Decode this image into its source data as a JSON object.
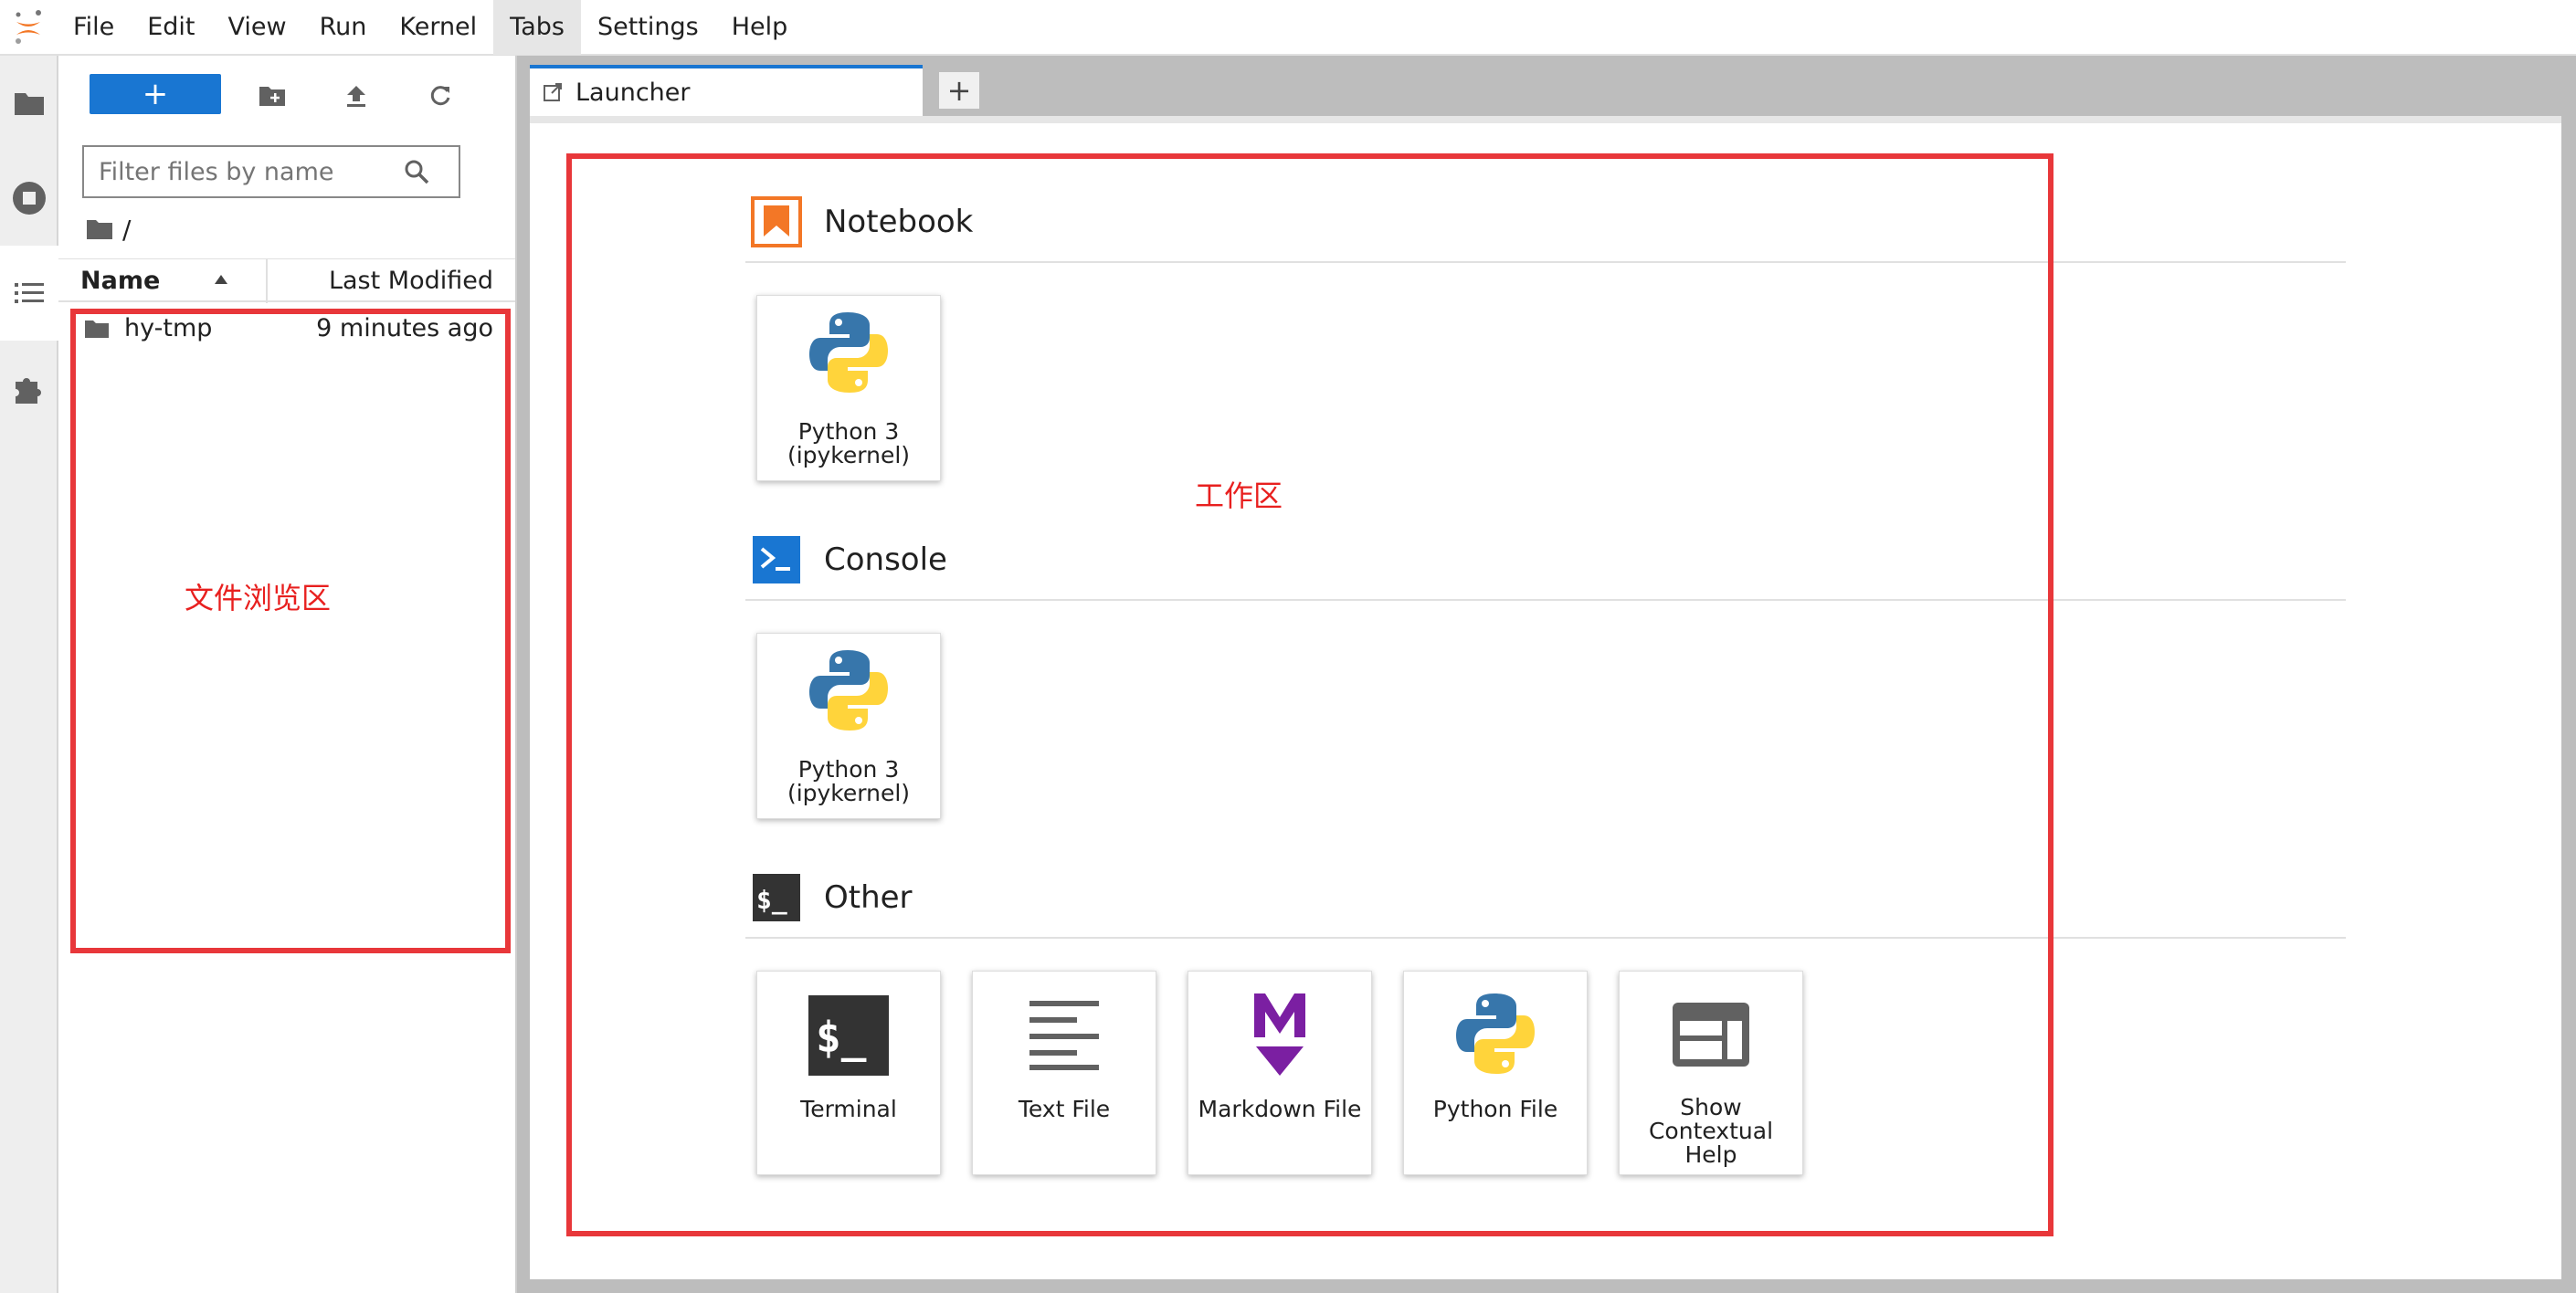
{
  "menubar": {
    "items": [
      "File",
      "Edit",
      "View",
      "Run",
      "Kernel",
      "Tabs",
      "Settings",
      "Help"
    ],
    "active_index": 5
  },
  "activity_bar": {
    "icons": [
      "folder-icon",
      "running-icon",
      "toc-icon",
      "extension-icon"
    ],
    "active_index": 2
  },
  "file_browser": {
    "new_button_label": "+",
    "filter_placeholder": "Filter files by name",
    "breadcrumb": "/",
    "columns": {
      "name": "Name",
      "modified": "Last Modified"
    },
    "rows": [
      {
        "name": "hy-tmp",
        "modified": "9 minutes ago",
        "type": "folder"
      }
    ],
    "annotation": "文件浏览区"
  },
  "tabs": {
    "launcher_label": "Launcher",
    "add_label": "+"
  },
  "launcher": {
    "annotation": "工作区",
    "sections": {
      "notebook": {
        "title": "Notebook",
        "cards": [
          {
            "line1": "Python 3",
            "line2": "(ipykernel)"
          }
        ]
      },
      "console": {
        "title": "Console",
        "cards": [
          {
            "line1": "Python 3",
            "line2": "(ipykernel)"
          }
        ]
      },
      "other": {
        "title": "Other",
        "cards": [
          {
            "label": "Terminal"
          },
          {
            "label": "Text File"
          },
          {
            "label": "Markdown File"
          },
          {
            "label": "Python File"
          },
          {
            "line1": "Show",
            "line2": "Contextual",
            "line3": "Help"
          }
        ]
      }
    }
  },
  "colors": {
    "accent": "#1976d2",
    "notebook_icon": "#f37726",
    "annotation_red": "#e8373a",
    "markdown_icon": "#7b1fa2",
    "terminal_bg": "#333333"
  }
}
